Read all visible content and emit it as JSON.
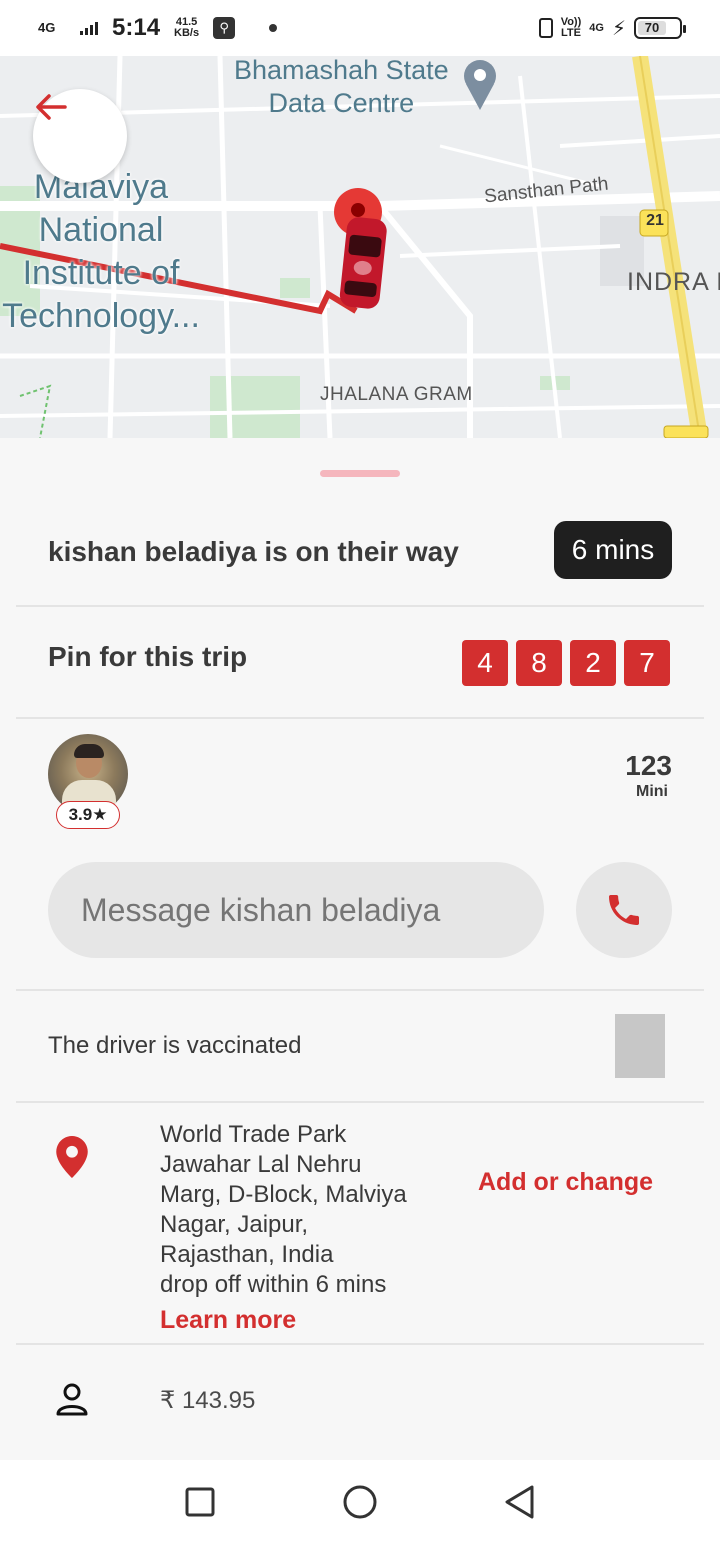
{
  "status_bar": {
    "network": "4G",
    "time": "5:14",
    "speed_value": "41.5",
    "speed_unit": "KB/s",
    "volte": "Vo))",
    "lte": "LTE",
    "net_right": "4G",
    "battery": "70"
  },
  "map": {
    "poi_1": "Bhamashah State",
    "poi_1b": "Data Centre",
    "poi_2_line1": "Malaviya",
    "poi_2_line2": "National",
    "poi_2_line3": "Institute of",
    "poi_2_line4": "Technology...",
    "road_1": "Sansthan Path",
    "route_no": "21",
    "area_1": "INDRA N",
    "area_2": "JHALANA GRAM"
  },
  "trip": {
    "driver_status": "kishan beladiya is on their way",
    "eta": "6 mins",
    "pin_label": "Pin for this trip",
    "pin": [
      "4",
      "8",
      "2",
      "7"
    ]
  },
  "driver": {
    "rating": "3.9★",
    "vehicle_plate": "123",
    "vehicle_type": "Mini",
    "message_placeholder": "Message kishan beladiya",
    "vaccinated_text": "The driver is vaccinated"
  },
  "destination": {
    "address_lines": [
      "World Trade Park",
      "Jawahar Lal Nehru",
      "Marg, D-Block, Malviya",
      "Nagar, Jaipur,",
      "Rajasthan, India",
      "drop off within 6 mins"
    ],
    "learn_more": "Learn more",
    "add_change": "Add or change"
  },
  "fare": {
    "amount": "₹ 143.95"
  },
  "colors": {
    "accent": "#d32f2f",
    "badge_dark": "#1f1f1f"
  }
}
